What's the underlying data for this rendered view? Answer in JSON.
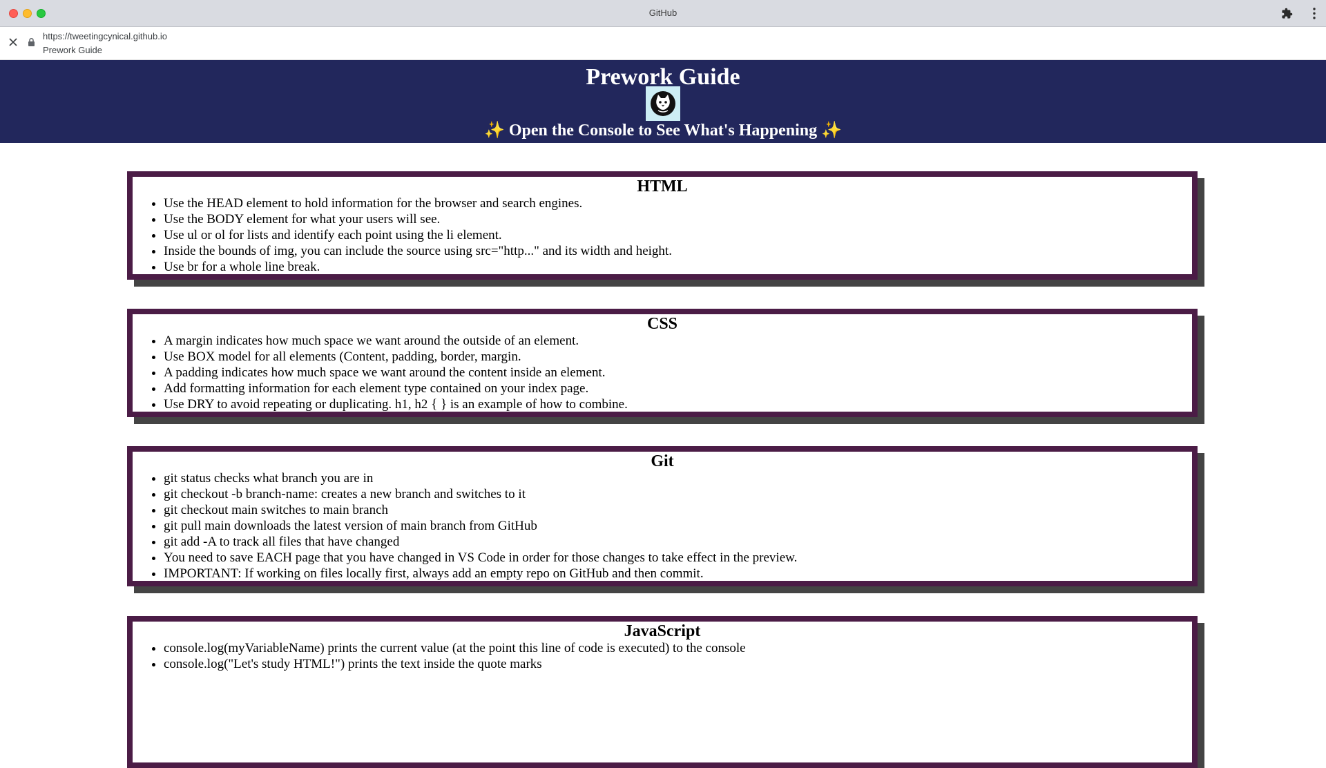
{
  "window": {
    "title": "GitHub"
  },
  "address": {
    "url": "https://tweetingcynical.github.io",
    "page_title": "Prework Guide"
  },
  "header": {
    "title": "Prework Guide",
    "subtitle_sparkle": "✨",
    "subtitle": "Open the Console to See What's Happening"
  },
  "sections": {
    "html": {
      "title": "HTML",
      "items": [
        "Use the HEAD element to hold information for the browser and search engines.",
        "Use the BODY element for what your users will see.",
        "Use ul or ol for lists and identify each point using the li element.",
        "Inside the bounds of img, you can include the source using src=\"http...\" and its width and height.",
        "Use br for a whole line break."
      ]
    },
    "css": {
      "title": "CSS",
      "items": [
        "A margin indicates how much space we want around the outside of an element.",
        "Use BOX model for all elements (Content, padding, border, margin.",
        "A padding indicates how much space we want around the content inside an element.",
        "Add formatting information for each element type contained on your index page.",
        "Use DRY to avoid repeating or duplicating. h1, h2 { } is an example of how to combine."
      ]
    },
    "git": {
      "title": "Git",
      "items": [
        "git status checks what branch you are in",
        "git checkout -b branch-name: creates a new branch and switches to it",
        "git checkout main switches to main branch",
        "git pull main downloads the latest version of main branch from GitHub",
        "git add -A to track all files that have changed",
        "You need to save EACH page that you have changed in VS Code in order for those changes to take effect in the preview.",
        "IMPORTANT: If working on files locally first, always add an empty repo on GitHub and then commit."
      ]
    },
    "javascript": {
      "title": "JavaScript",
      "items": [
        "console.log(myVariableName) prints the current value (at the point this line of code is executed) to the console",
        "console.log(\"Let's study HTML!\") prints the text inside the quote marks"
      ]
    }
  },
  "colors": {
    "header_bg": "#22275c",
    "card_border": "#4b1c46",
    "card_shadow": "#444444"
  },
  "icons": [
    "extensions-icon",
    "menu-icon",
    "close-icon",
    "lock-icon",
    "cat-avatar-icon",
    "sparkle-icon"
  ]
}
